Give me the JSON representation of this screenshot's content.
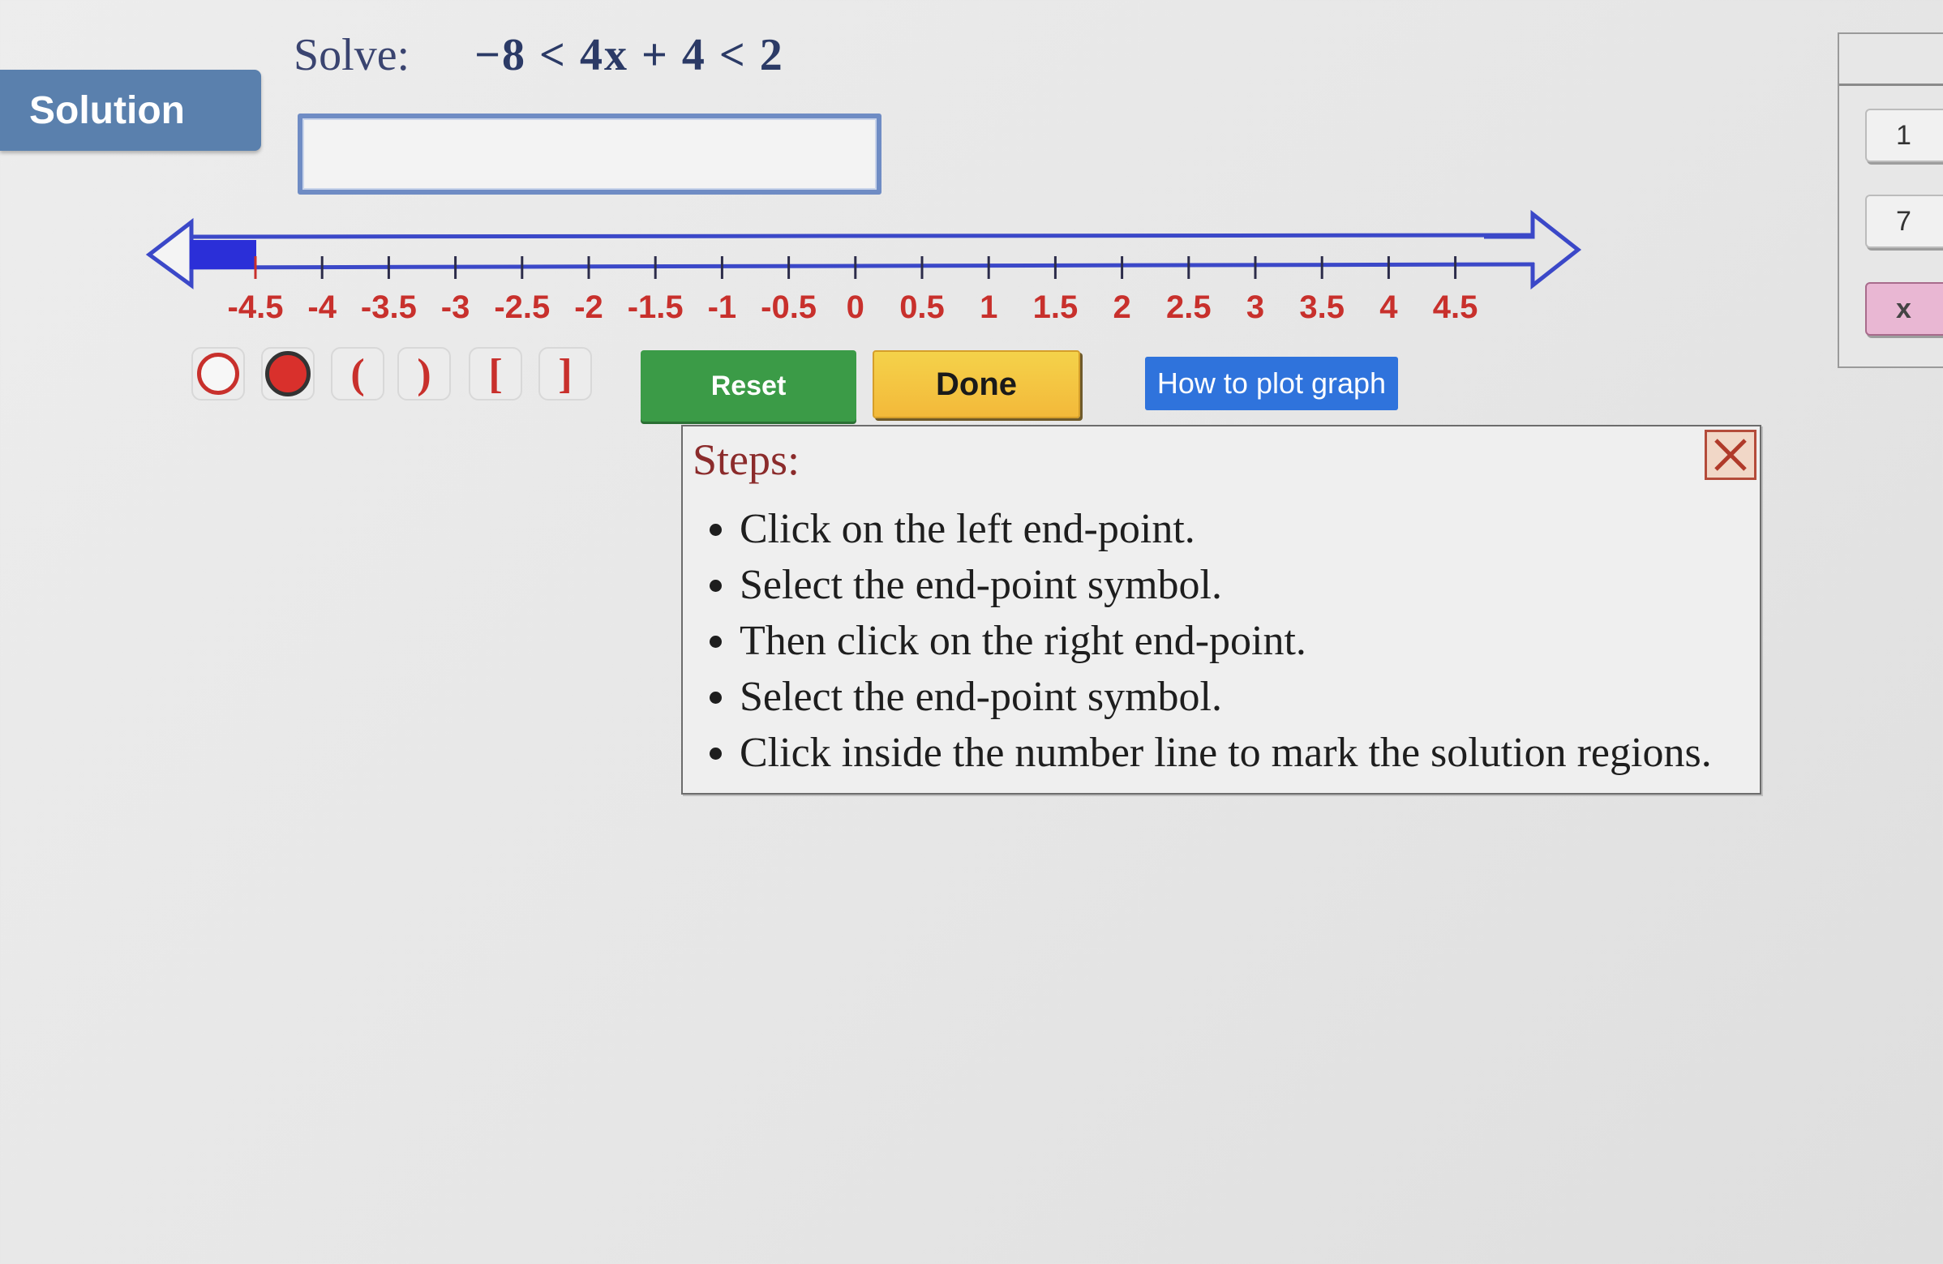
{
  "solution_tab": {
    "label": "Solution"
  },
  "problem": {
    "label": "Solve:",
    "expression": "−8 < 4x + 4 < 2"
  },
  "answer_box": {
    "value": ""
  },
  "number_line": {
    "ticks": [
      "-4.5",
      "-4",
      "-3.5",
      "-3",
      "-2.5",
      "-2",
      "-1.5",
      "-1",
      "-0.5",
      "0",
      "0.5",
      "1",
      "1.5",
      "2",
      "2.5",
      "3",
      "3.5",
      "4",
      "4.5"
    ],
    "tick_color": "#c8302c",
    "axis_color": "#3b48c8",
    "shaded_region": {
      "from": "-5",
      "to": "-4.5"
    }
  },
  "tools": {
    "open_circle": "open-circle-icon",
    "filled_circle": "filled-circle-icon",
    "open_paren": "(",
    "close_paren": ")",
    "open_bracket": "[",
    "close_bracket": "]"
  },
  "buttons": {
    "reset": "Reset",
    "done": "Done",
    "how_to": "How to plot graph"
  },
  "steps": {
    "title": "Steps:",
    "items": [
      "Click on the left end-point.",
      "Select the end-point symbol.",
      "Then click on the right end-point.",
      "Select the end-point symbol.",
      "Click inside the number line to mark the solution regions."
    ]
  },
  "side_panel": {
    "keys": [
      "1",
      "7",
      "x"
    ]
  }
}
